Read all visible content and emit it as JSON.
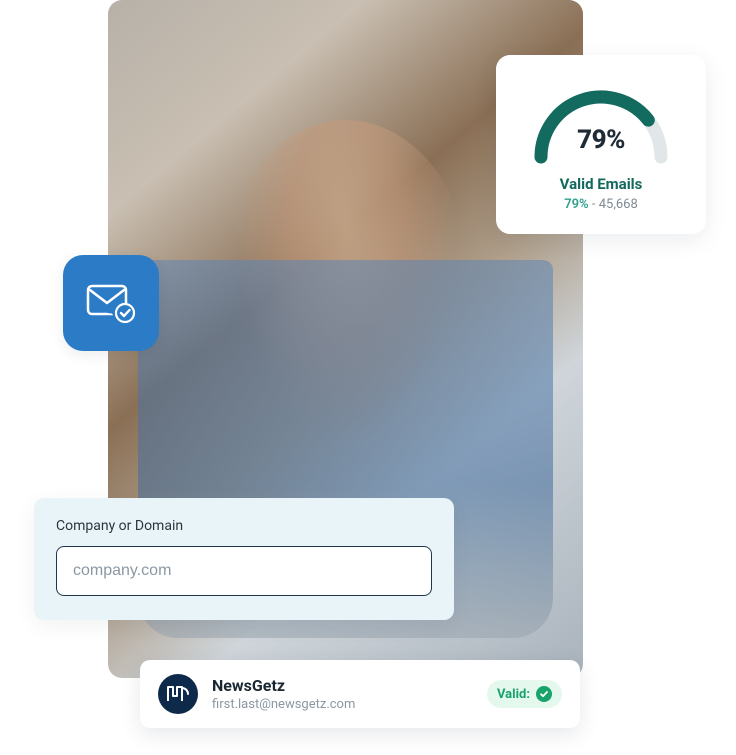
{
  "gauge": {
    "value_text": "79%",
    "title": "Valid Emails",
    "sub_pct": "79%",
    "sub_sep": " - ",
    "sub_count": "45,668",
    "accent": "#136b60",
    "track": "#e1e6e9"
  },
  "search": {
    "label": "Company or Domain",
    "placeholder": "company.com"
  },
  "result": {
    "logo_text": "ΠG",
    "name": "NewsGetz",
    "email": "first.last@newsgetz.com",
    "valid_label": "Valid:"
  },
  "icons": {
    "mail": "mail-verified-icon"
  }
}
